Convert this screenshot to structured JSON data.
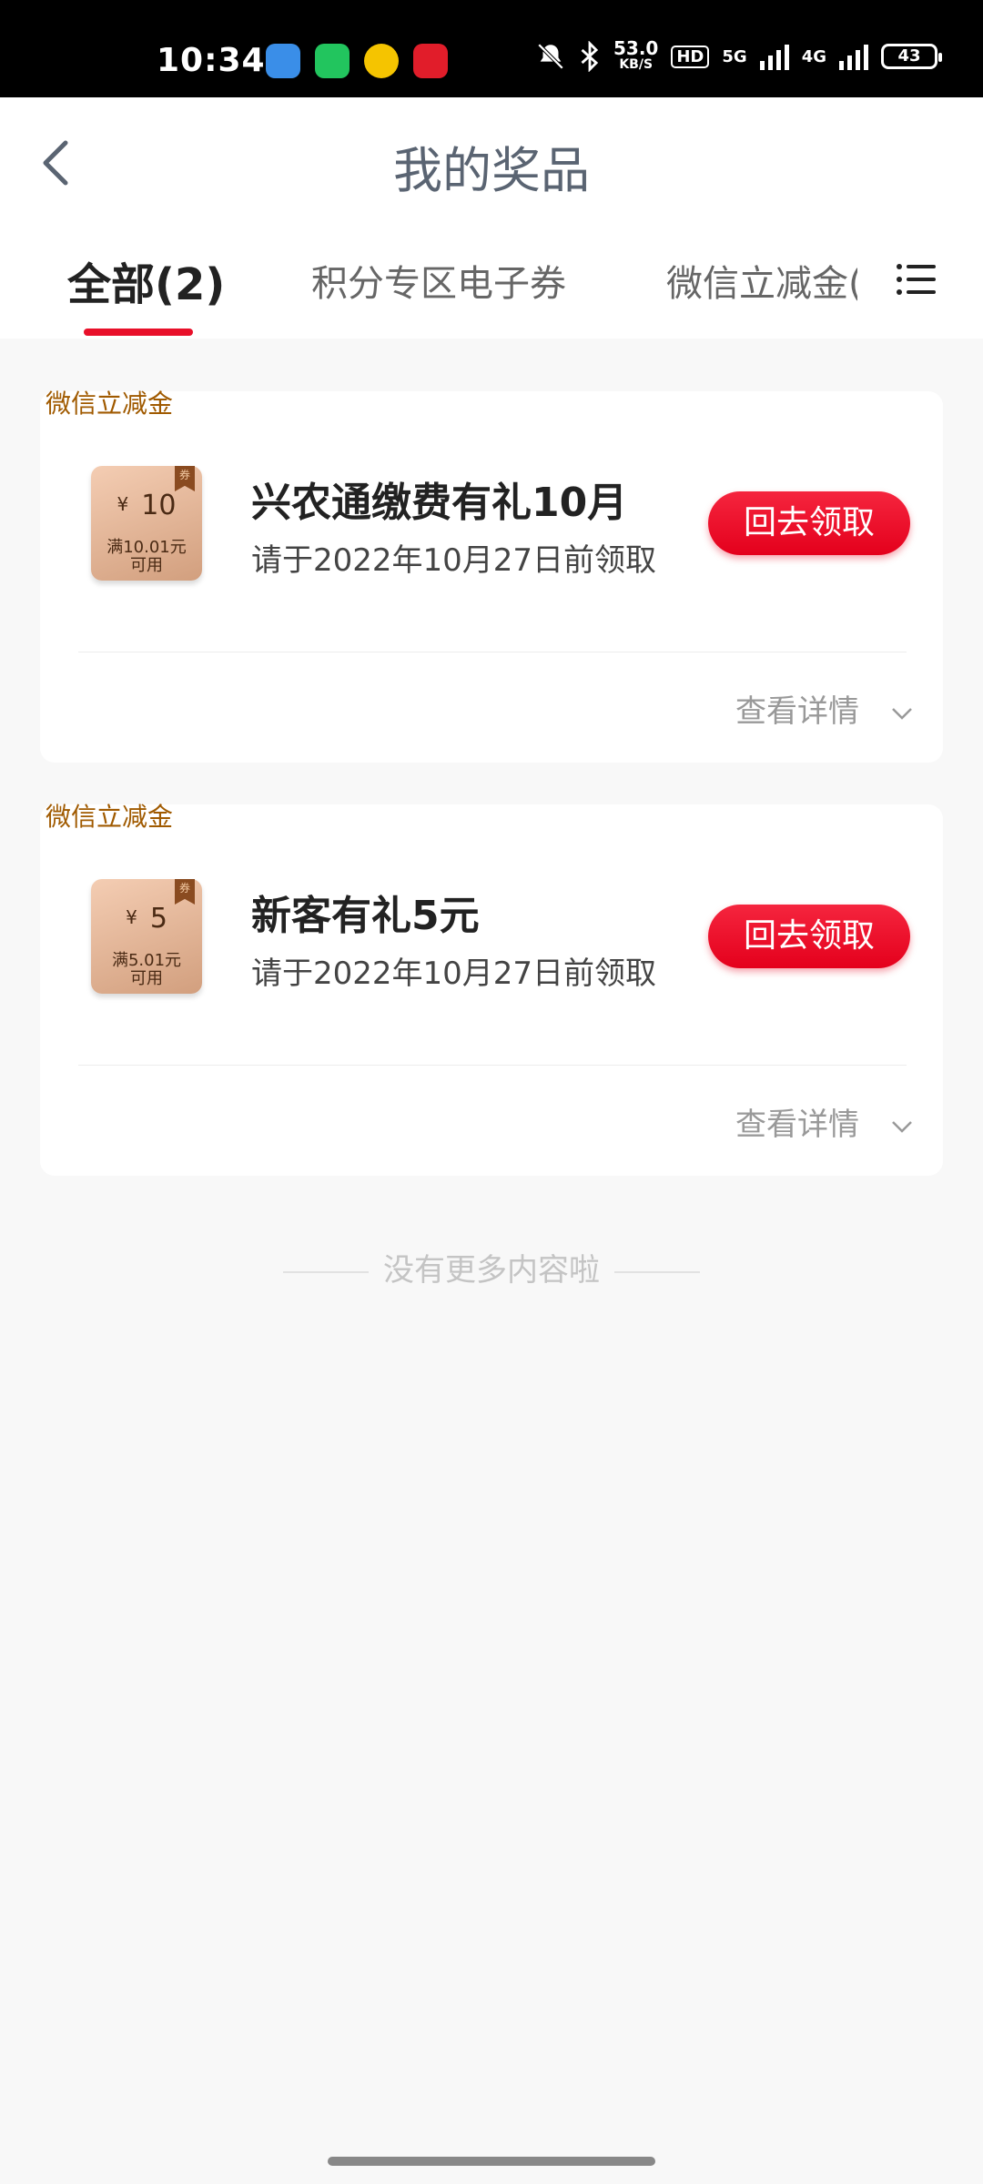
{
  "status_bar": {
    "time": "10:34",
    "net_speed": "53.0",
    "net_unit": "KB/S",
    "hd": "HD",
    "sig5g": "5G",
    "sig4g": "4G",
    "battery": "43",
    "apps": [
      {
        "name": "browser-app-icon",
        "color": "#3a8ee8"
      },
      {
        "name": "message-app-icon",
        "color": "#22c55e"
      },
      {
        "name": "security-app-icon",
        "color": "#f5c400"
      },
      {
        "name": "bank-app-icon",
        "color": "#e11d2a"
      }
    ]
  },
  "header": {
    "title": "我的奖品",
    "tabs": [
      {
        "label": "全部(2)",
        "active": true
      },
      {
        "label": "积分专区电子券",
        "active": false
      },
      {
        "label": "微信立减金(",
        "active": false
      }
    ]
  },
  "prizes": [
    {
      "tag": "微信立减金",
      "coupon_currency": "¥",
      "coupon_value": "10",
      "coupon_condition_line1": "满10.01元",
      "coupon_condition_line2": "可用",
      "coupon_flag": "券",
      "name": "兴农通缴费有礼10月",
      "deadline": "请于2022年10月27日前领取",
      "claim_label": "回去领取",
      "details_label": "查看详情"
    },
    {
      "tag": "微信立减金",
      "coupon_currency": "¥",
      "coupon_value": "5",
      "coupon_condition_line1": "满5.01元",
      "coupon_condition_line2": "可用",
      "coupon_flag": "券",
      "name": "新客有礼5元",
      "deadline": "请于2022年10月27日前领取",
      "claim_label": "回去领取",
      "details_label": "查看详情"
    }
  ],
  "footer": {
    "no_more": "没有更多内容啦"
  },
  "colors": {
    "accent": "#e8102a",
    "title": "#5a6472",
    "tag": "#a05a00"
  }
}
